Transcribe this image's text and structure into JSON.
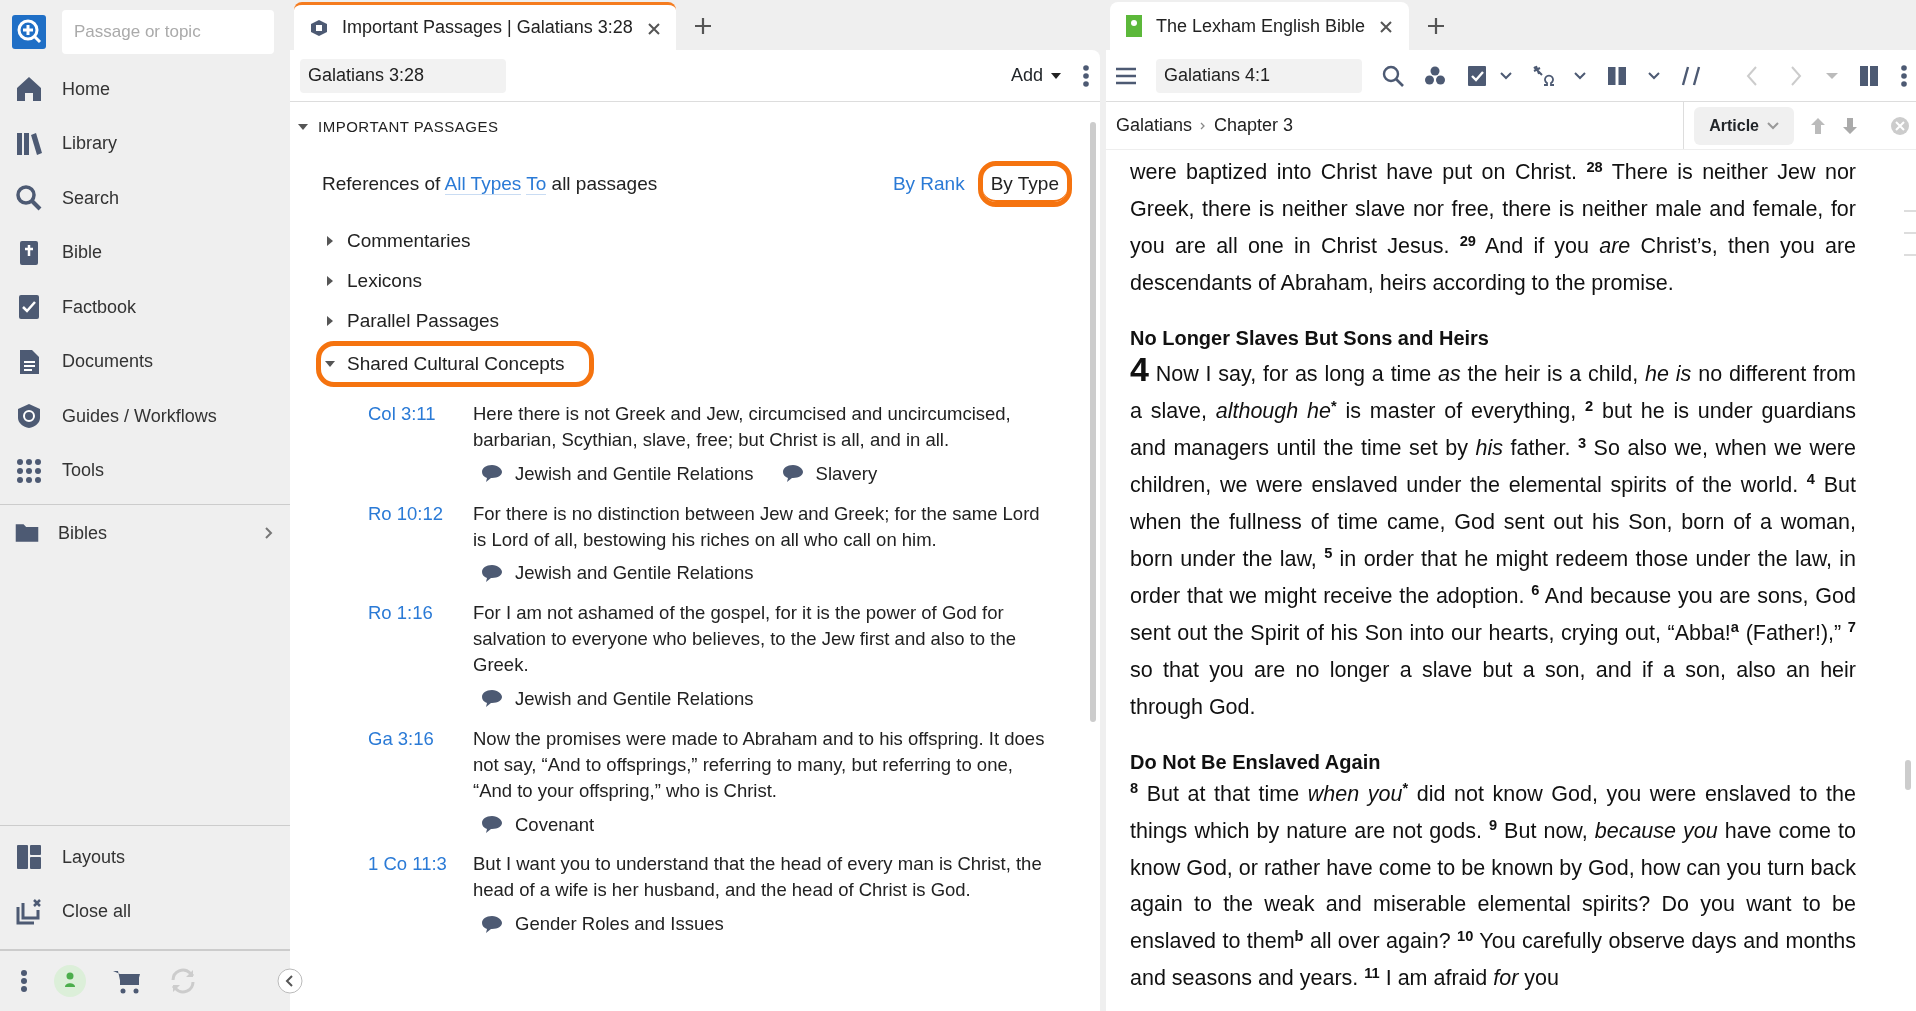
{
  "sidebar": {
    "search": {
      "placeholder": "Passage or topic"
    },
    "items": [
      {
        "label": "Home",
        "kind": "home"
      },
      {
        "label": "Library",
        "kind": "library"
      },
      {
        "label": "Search",
        "kind": "search"
      },
      {
        "label": "Bible",
        "kind": "bible"
      },
      {
        "label": "Factbook",
        "kind": "factbook"
      },
      {
        "label": "Documents",
        "kind": "documents"
      },
      {
        "label": "Guides / Workflows",
        "kind": "guides"
      },
      {
        "label": "Tools",
        "kind": "tools"
      }
    ],
    "folders": [
      {
        "label": "Bibles",
        "expanded": false
      }
    ],
    "bottom_items": [
      {
        "label": "Layouts",
        "kind": "layouts"
      },
      {
        "label": "Close all",
        "kind": "closeall"
      }
    ]
  },
  "middle": {
    "tab": {
      "title": "Important Passages | Galatians 3:28",
      "selected": true
    },
    "reference": "Galatians 3:28",
    "add_button": "Add",
    "section": {
      "title": "IMPORTANT PASSAGES",
      "expanded": true
    },
    "filter": {
      "prefix": "References of",
      "link_1": "All Types",
      "link_2": "To",
      "suffix": "all passages"
    },
    "views": [
      {
        "label": "By Rank",
        "selected": false,
        "highlighted": false
      },
      {
        "label": "By Type",
        "selected": true,
        "highlighted": true
      }
    ],
    "groups": [
      {
        "label": "Commentaries",
        "expanded": false,
        "highlighted": false
      },
      {
        "label": "Lexicons",
        "expanded": false,
        "highlighted": false
      },
      {
        "label": "Parallel Passages",
        "expanded": false,
        "highlighted": false
      },
      {
        "label": "Shared Cultural Concepts",
        "expanded": true,
        "highlighted": true
      }
    ],
    "passages": [
      {
        "ref": "Col 3:11",
        "text": "Here there is not Greek and Jew, circumcised and uncircumcised, barbarian, Scythian, slave, free; but Christ is all, and in all.",
        "concepts": [
          "Jewish and Gentile Relations",
          "Slavery"
        ]
      },
      {
        "ref": "Ro 10:12",
        "text": "For there is no distinction between Jew and Greek; for the same Lord is Lord of all, bestowing his riches on all who call on him.",
        "concepts": [
          "Jewish and Gentile Relations"
        ]
      },
      {
        "ref": "Ro 1:16",
        "text": "For I am not ashamed of the gospel, for it is the power of God for salvation to everyone who believes, to the Jew first and also to the Greek.",
        "concepts": [
          "Jewish and Gentile Relations"
        ]
      },
      {
        "ref": "Ga 3:16",
        "text": "Now the promises were made to Abraham and to his offspring. It does not say, “And to offsprings,” referring to many, but referring to one, “And to your offspring,” who is Christ.",
        "concepts": [
          "Covenant"
        ]
      },
      {
        "ref": "1 Co 11:3",
        "text": "But I want you to understand that the head of every man is Christ, the head of a wife is her husband, and the head of Christ is God.",
        "concepts": [
          "Gender Roles and Issues"
        ]
      }
    ]
  },
  "reader": {
    "tab": {
      "title": "The Lexham English Bible",
      "selected": true
    },
    "reference": "Galatians 4:1",
    "breadcrumb": [
      "Galatians",
      "Chapter 3"
    ],
    "view_button": "Article",
    "blocks": [
      {
        "kind": "paragraph",
        "text": "were baptized into Christ have put on Christ. $^{28}$ There is neither Jew nor Greek, there is neither slave nor free, there is neither male and female, for you are all one in Christ Jesus. $^{29}$ And if you *are* Christ’s, then you are descendants of Abraham, heirs according to the promise."
      },
      {
        "kind": "heading",
        "text": "No Longer Slaves But Sons and Heirs"
      },
      {
        "kind": "chapter",
        "number": "4",
        "text": "Now I say, for as long a time *as* the heir is a child, *he is* no different from a slave, *although he*$^{*}$ is master of everything, $^{2}$ but he is under guardians and managers until the time set by *his* father. $^{3}$ So also we, when we were children, we were enslaved under the elemental spirits of the world. $^{4}$ But when the fullness of time came, God sent out his Son, born of a woman, born under the law, $^{5}$ in order that he might redeem those under the law, in order that we might receive the adoption. $^{6}$ And because you are sons, God sent out the Spirit of his Son into our hearts, crying out, “Abba!$^{a}$ (Father!),” $^{7}$ so that you are no longer a slave but a son, and if a son, also an heir through God."
      },
      {
        "kind": "heading",
        "text": "Do Not Be Enslaved Again"
      },
      {
        "kind": "paragraph",
        "text": "$^{8}$ But at that time *when you*$^{*}$ did not know God, you were enslaved to the things which by nature are not gods. $^{9}$ But now, *because you* have come to know God, or rather have come to be known by God, how can you turn back again to the weak and miserable elemental spirits? Do you want to be enslaved to them$^{b}$ all over again? $^{10}$ You carefully observe days and months and seasons and years. $^{11}$ I am afraid *for* you"
      }
    ]
  }
}
